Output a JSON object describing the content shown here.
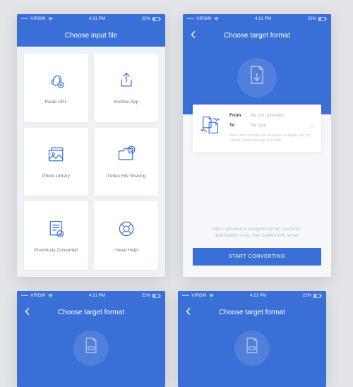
{
  "status": {
    "carrier": "VIRGIN",
    "time": "4:21 PM",
    "battery": "22%",
    "colors": {
      "primary": "#3a6fd8",
      "bg": "#e2e4e8"
    }
  },
  "screen1": {
    "title": "Choose input file",
    "tiles": [
      {
        "label": "Paste URL",
        "icon": "link-plus-icon"
      },
      {
        "label": "Another App",
        "icon": "share-icon"
      },
      {
        "label": "Photo Library",
        "icon": "photo-library-icon"
      },
      {
        "label": "iTunes File Sharing",
        "icon": "folder-sync-icon"
      },
      {
        "label": "Prevoiusly Converted",
        "icon": "document-check-icon"
      },
      {
        "label": "I Need Help!",
        "icon": "lifebuoy-icon"
      }
    ]
  },
  "screen2": {
    "title": "Choose target format",
    "hero_icon": "file-download-icon",
    "card": {
      "icon": "file-swap-icon",
      "from_label": "From",
      "from_value": "file not uploaded",
      "to_label": "To",
      "to_value": "file type",
      "hint": "Note: more formats are supported as target, but you cannot convert among all of them"
    },
    "info": "File is uploaded to encrypted server, converted, downloaded to you, then deleted from server.",
    "cta": "START CONVERTING"
  },
  "screen3": {
    "title": "Choose target format",
    "hero_icon": "file-type-icon"
  },
  "screen4": {
    "title": "Choose target format",
    "hero_icon": "file-type-icon"
  }
}
